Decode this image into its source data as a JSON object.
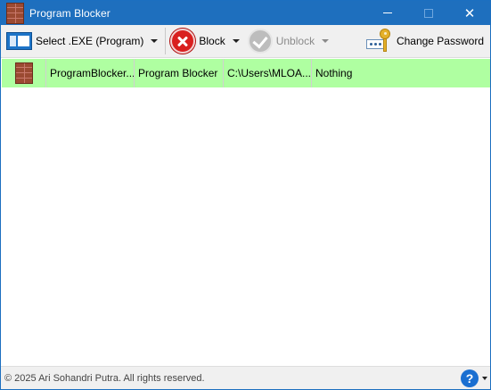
{
  "window": {
    "title": "Program Blocker"
  },
  "toolbar": {
    "select_exe_label": "Select .EXE (Program)",
    "block_label": "Block",
    "unblock_label": "Unblock",
    "change_password_label": "Change Password"
  },
  "list": {
    "rows": [
      {
        "name": "ProgramBlocker...",
        "description": "Program Blocker",
        "path": "C:\\Users\\MLOA...",
        "status": "Nothing"
      }
    ]
  },
  "statusbar": {
    "copyright": "© 2025 Ari Sohandri Putra. All rights reserved."
  },
  "colors": {
    "titlebar": "#1e6fbe",
    "row_highlight": "#afffa1",
    "block_red": "#d9201f",
    "help_blue": "#1a6fd1"
  }
}
